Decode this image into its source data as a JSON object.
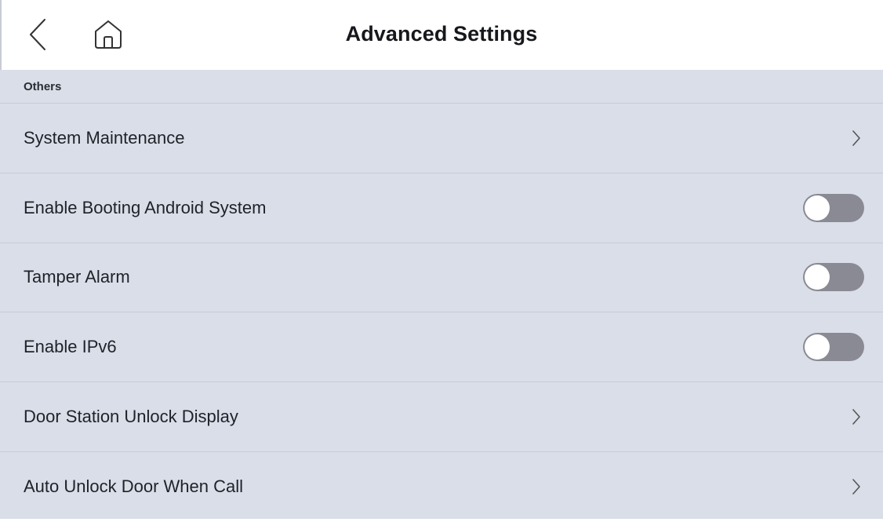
{
  "header": {
    "title": "Advanced Settings",
    "back_icon": "chevron-left-icon",
    "home_icon": "home-icon"
  },
  "section": {
    "title": "Others"
  },
  "rows": [
    {
      "label": "System Maintenance",
      "type": "link"
    },
    {
      "label": "Enable Booting Android System",
      "type": "toggle",
      "enabled": false
    },
    {
      "label": "Tamper Alarm",
      "type": "toggle",
      "enabled": false
    },
    {
      "label": "Enable IPv6",
      "type": "toggle",
      "enabled": false
    },
    {
      "label": "Door Station Unlock Display",
      "type": "link"
    },
    {
      "label": "Auto Unlock Door When Call",
      "type": "link"
    }
  ],
  "colors": {
    "background": "#d9dee8",
    "toggle_off": "#8a8a94",
    "divider": "#c6cbd5"
  }
}
